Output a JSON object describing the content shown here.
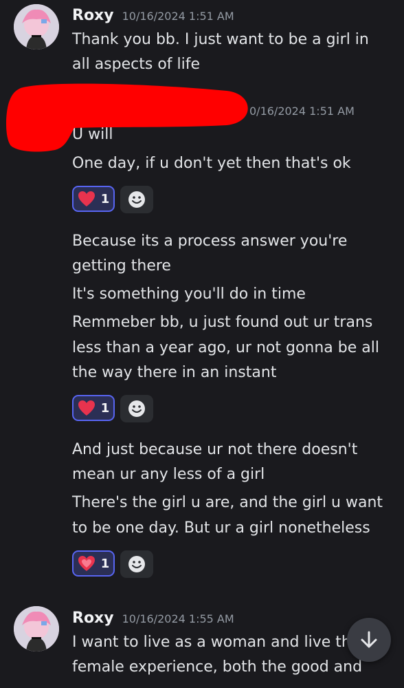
{
  "messages": [
    {
      "username": "Roxy",
      "timestamp": "10/16/2024 1:51 AM",
      "lines": [
        "Thank you bb. I just want to be a girl in",
        "all aspects of life"
      ]
    },
    {
      "username": "",
      "timestamp": "10/16/2024 1:51 AM",
      "timestamp_visible": "0/16/2024 1:51 AM",
      "lines": [
        "U will",
        "One day, if u don't yet then that's ok"
      ],
      "reaction": {
        "emoji": "heart-icon",
        "count": "1"
      }
    },
    {
      "lines": [
        "Because its a process answer you're",
        "getting there",
        "It's something you'll do in time",
        "Remmeber bb, u just found out ur trans",
        "less than a year ago, ur not gonna be all",
        "the way there in an instant"
      ],
      "reaction": {
        "emoji": "heart-icon",
        "count": "1"
      }
    },
    {
      "lines": [
        "And just because ur not there doesn't",
        "mean ur any less of a girl",
        "There's the girl u are, and the girl u want",
        "to be one day. But ur a girl nonetheless"
      ],
      "reaction": {
        "emoji": "heart-icon",
        "count": "1"
      }
    },
    {
      "username": "Roxy",
      "timestamp": "10/16/2024 1:55 AM",
      "lines": [
        "I want to live as a woman and live th",
        "female experience, both the good and"
      ]
    }
  ],
  "colors": {
    "background": "#1a1a1e",
    "reaction_border": "#5865f2",
    "redaction": "#ff0000"
  }
}
